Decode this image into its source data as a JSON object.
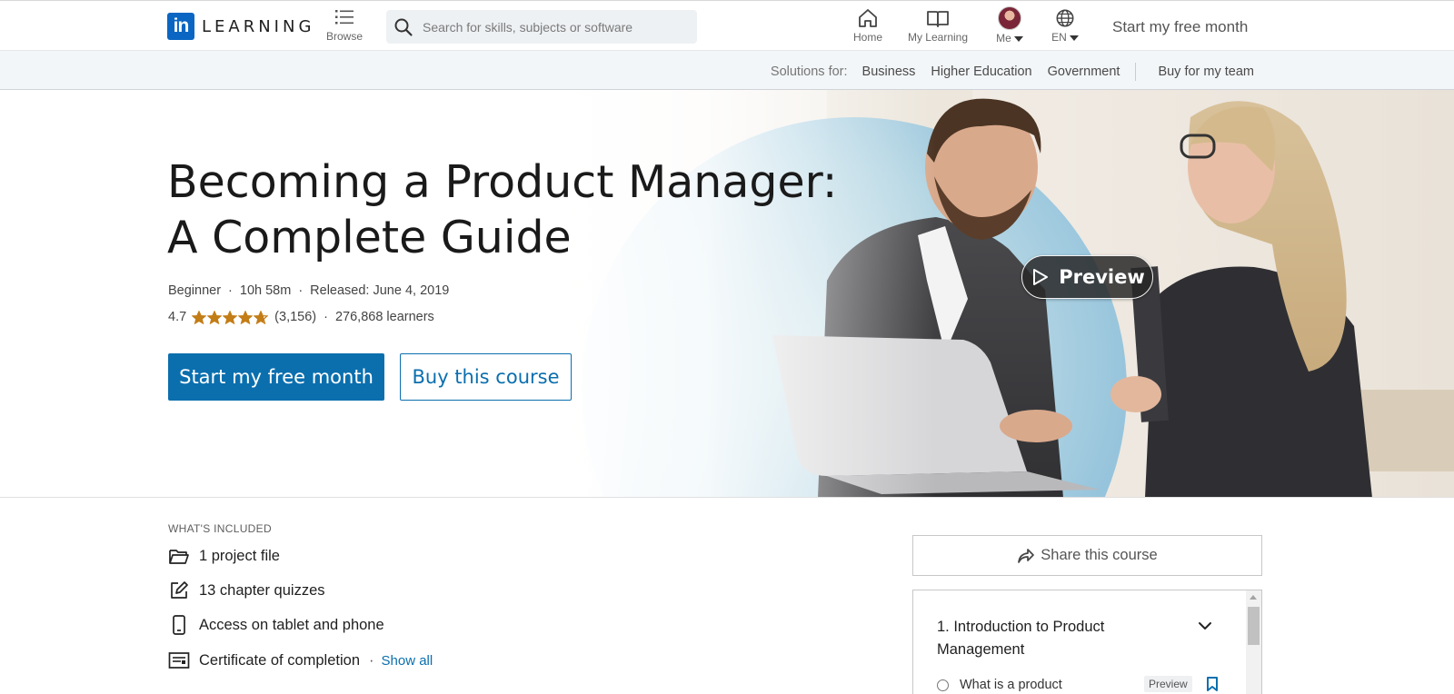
{
  "header": {
    "logo_text": "LEARNING",
    "logo_badge": "in",
    "browse_label": "Browse",
    "search_placeholder": "Search for skills, subjects or software",
    "nav": {
      "home": "Home",
      "my_learning": "My Learning",
      "me": "Me",
      "language": "EN"
    },
    "cta": "Start my free month"
  },
  "subnav": {
    "solutions_label": "Solutions for:",
    "links": [
      "Business",
      "Higher Education",
      "Government"
    ],
    "team": "Buy for my team"
  },
  "hero": {
    "title": "Becoming a Product Manager: A Complete Guide",
    "level": "Beginner",
    "duration": "10h 58m",
    "released": "Released: June 4, 2019",
    "rating": "4.7",
    "rating_value": 4.7,
    "rating_count": "(3,156)",
    "learners": "276,868 learners",
    "primary_button": "Start my free month",
    "secondary_button": "Buy this course",
    "preview_label": "Preview"
  },
  "included": {
    "heading": "WHAT'S INCLUDED",
    "items": [
      {
        "icon": "folder-icon",
        "label": "1 project file"
      },
      {
        "icon": "edit-icon",
        "label": "13 chapter quizzes"
      },
      {
        "icon": "phone-icon",
        "label": "Access on tablet and phone"
      },
      {
        "icon": "certificate-icon",
        "label": "Certificate of completion"
      }
    ],
    "show_all": "Show all"
  },
  "sidebar": {
    "share_label": "Share this course",
    "chapter_title": "1. Introduction to Product Management",
    "lesson_title": "What is a product",
    "lesson_tag": "Preview"
  },
  "colors": {
    "brand": "#0b6fae",
    "star": "#c37d16"
  }
}
